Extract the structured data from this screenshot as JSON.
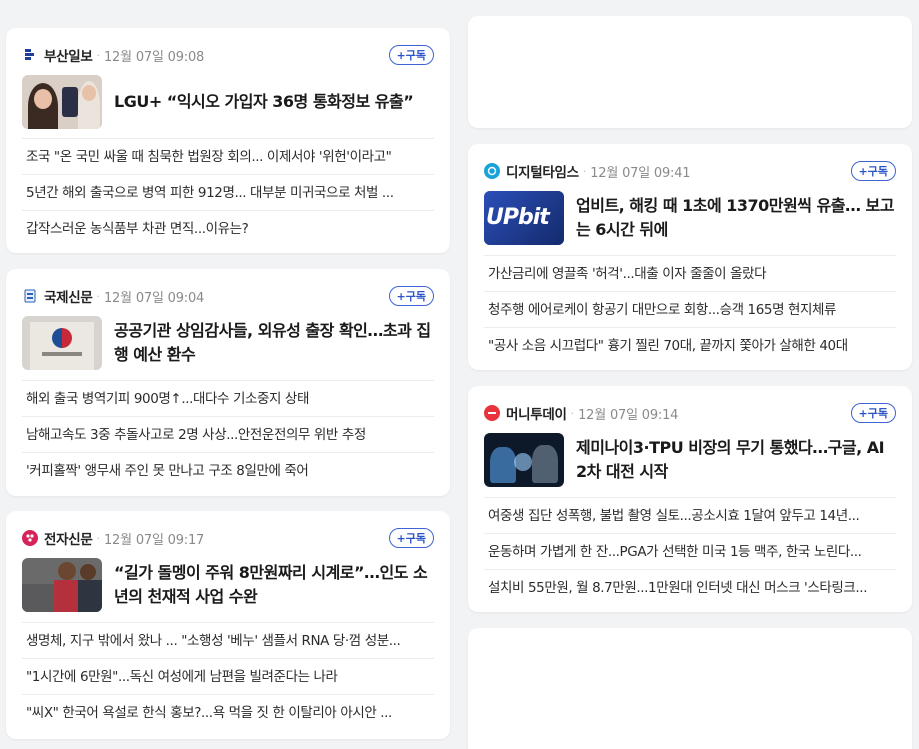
{
  "left": [
    {
      "press": "부산일보",
      "time": "12월 07일 09:08",
      "subscribe": "+구독",
      "logo_color": "#1d3f9a",
      "headline": "LGU+ “익시오 가입자 36명 통화정보 유출”",
      "thumb_icon": "phone-people-photo",
      "items": [
        "조국 \"온 국민 싸울 때 침묵한 법원장 회의... 이제서야 '위헌'이라고\"",
        "5년간 해외 출국으로 병역 피한 912명... 대부분 미귀국으로 처벌 ...",
        "갑작스러운 농식품부 차관 면직...이유는?"
      ]
    },
    {
      "press": "국제신문",
      "time": "12월 07일 09:04",
      "subscribe": "+구독",
      "logo_color": "#2a62b5",
      "headline": "공공기관 상임감사들, 외유성 출장 확인…초과 집행 예산 환수",
      "thumb_icon": "government-sign-photo",
      "items": [
        "해외 출국 병역기피 900명↑...대다수 기소중지 상태",
        "남해고속도 3중 추돌사고로 2명 사상...안전운전의무 위반 추정",
        "'커피홀짝' 앵무새 주인 못 만나고 구조 8일만에 죽어"
      ]
    },
    {
      "press": "전자신문",
      "time": "12월 07일 09:17",
      "subscribe": "+구독",
      "logo_color": "#d6245a",
      "headline": "“길가 돌멩이 주워 8만원짜리 시계로”…인도 소년의 천재적 사업 수완",
      "thumb_icon": "boy-watch-photo",
      "items": [
        "생명체, 지구 밖에서 왔나 ... \"소행성 '베누' 샘플서 RNA 당·껌 성분...",
        "\"1시간에 6만원\"...독신 여성에게 남편을 빌려준다는 나라",
        "\"씨X\" 한국어 욕설로 한식 홍보?...욕 먹을 짓 한 이탈리아 아시안 ..."
      ]
    }
  ],
  "right": [
    {
      "press": "디지털타임스",
      "time": "12월 07일 09:41",
      "subscribe": "+구독",
      "logo_color": "#1aa3d9",
      "headline": "업비트, 해킹 때 1초에 1370만원씩 유출… 보고는 6시간 뒤에",
      "thumb_icon": "upbit-sign-photo",
      "thumb_text": "UPbit",
      "items": [
        "가산금리에 영끌족 '허걱'...대출 이자 줄줄이 올랐다",
        "청주행 에어로케이 항공기 대만으로 회항...승객 165명 현지체류",
        "\"공사 소음 시끄럽다\" 흉기 찔린 70대, 끝까지 쫓아가 살해한 40대"
      ]
    },
    {
      "press": "머니투데이",
      "time": "12월 07일 09:14",
      "subscribe": "+구독",
      "logo_color": "#e8323c",
      "headline": "제미나이3·TPU 비장의 무기 통했다…구글, AI 2차 대전 시작",
      "thumb_icon": "robots-battle-photo",
      "items": [
        "여중생 집단 성폭행, 불법 촬영 실토...공소시효 1달여 앞두고 14년...",
        "운동하며 가볍게 한 잔...PGA가 선택한 미국 1등 맥주, 한국 노린다...",
        "설치비 55만원, 월 8.7만원...1만원대 인터넷 대신 머스크 '스타링크..."
      ]
    }
  ]
}
